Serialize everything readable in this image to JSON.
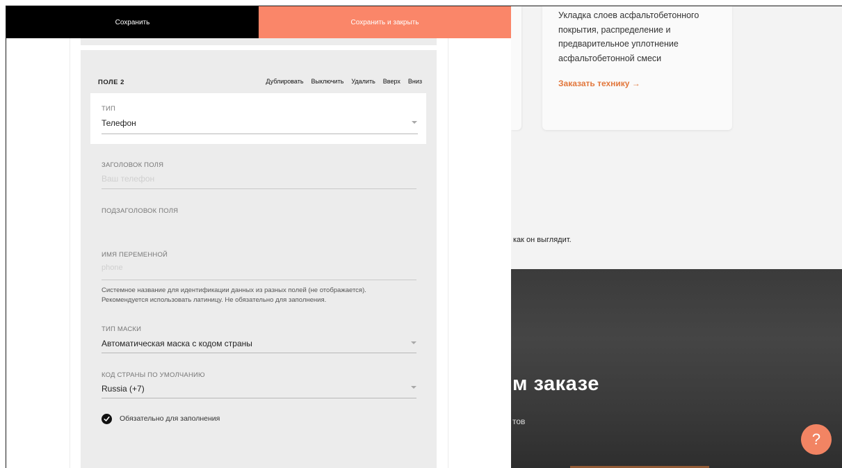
{
  "toolbar": {
    "save_label": "Сохранить",
    "save_close_label": "Сохранить и закрыть"
  },
  "field": {
    "title": "ПОЛЕ 2",
    "actions": {
      "duplicate": "Дублировать",
      "disable": "Выключить",
      "delete": "Удалить",
      "up": "Вверх",
      "down": "Вниз"
    },
    "type": {
      "label": "ТИП",
      "value": "Телефон"
    },
    "field_title": {
      "label": "ЗАГОЛОВОК ПОЛЯ",
      "placeholder": "Ваш телефон"
    },
    "field_subtitle": {
      "label": "ПОДЗАГОЛОВОК ПОЛЯ",
      "value": ""
    },
    "variable_name": {
      "label": "ИМЯ ПЕРЕМЕННОЙ",
      "placeholder": "phone",
      "description_line1": "Системное название для идентификации данных из разных полей (не отображается).",
      "description_line2": "Рекомендуется использовать латиницу. Не обязательно для заполнения."
    },
    "mask_type": {
      "label": "ТИП МАСКИ",
      "value": "Автоматическая маска с кодом страны"
    },
    "country_code": {
      "label": "КОД СТРАНЫ ПО УМОЛЧАНИЮ",
      "value": "Russia (+7)"
    },
    "required": {
      "label": "Обязательно для заполнения",
      "checked": true
    }
  },
  "site_preview": {
    "card_description": "Укладка слоев асфальтобетонного покрытия, распределение и предварительное уплотнение асфальтобетонной смеси",
    "card_link": "Заказать технику →",
    "hint": "как он выглядит.",
    "dark_title": "м заказе",
    "dark_subtitle": "тов",
    "help_button": "?"
  },
  "colors": {
    "accent": "#fa8669",
    "toolbar_dark": "#000000",
    "field_bg": "#ececec",
    "link_orange": "#e2773c"
  }
}
